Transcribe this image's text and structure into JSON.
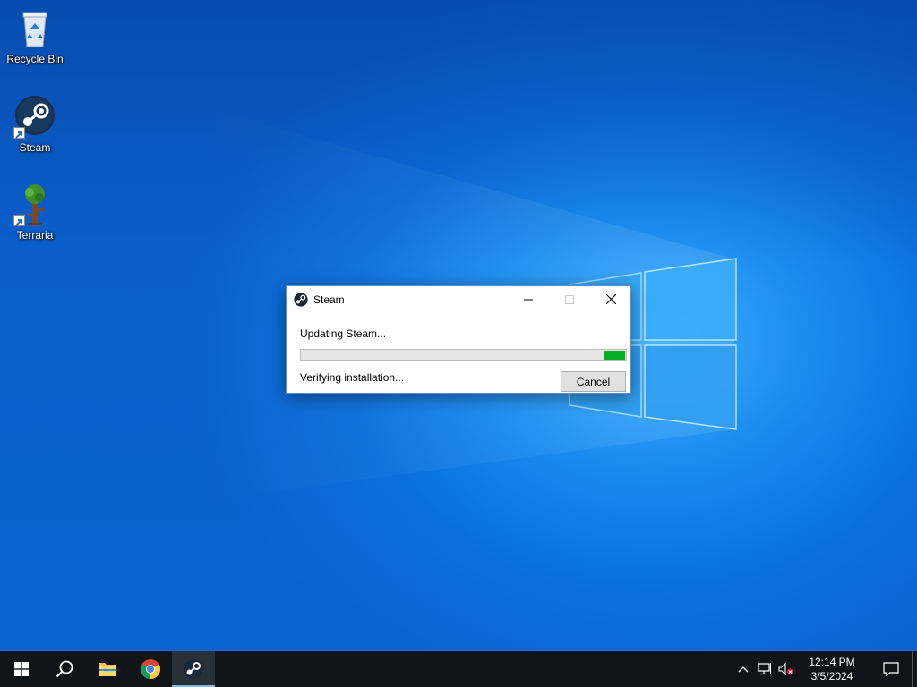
{
  "desktop": {
    "icons": [
      {
        "label": "Recycle Bin",
        "icon": "recycle-bin-icon"
      },
      {
        "label": "Steam",
        "icon": "steam-icon"
      },
      {
        "label": "Terraria",
        "icon": "terraria-icon"
      }
    ]
  },
  "dialog": {
    "title": "Steam",
    "status": "Updating Steam...",
    "detail": "Verifying installation...",
    "progress": 0.065,
    "cancel_label": "Cancel",
    "minimize_glyph": "—",
    "maximize_glyph": "☐",
    "close_glyph": "✕"
  },
  "taskbar": {
    "items": [
      {
        "name": "start-button",
        "icon": "windows-logo-icon"
      },
      {
        "name": "search-button",
        "icon": "search-icon"
      },
      {
        "name": "file-explorer",
        "icon": "folder-icon"
      },
      {
        "name": "chrome",
        "icon": "chrome-icon"
      },
      {
        "name": "steam",
        "icon": "steam-icon",
        "active": true
      }
    ],
    "tray": {
      "time": "12:14 PM",
      "date": "3/5/2024",
      "icons": [
        "chevron-up-icon",
        "network-icon",
        "volume-muted-icon",
        "notification-icon"
      ]
    }
  },
  "colors": {
    "progress_fill": "#06b025",
    "taskbar": "#101418",
    "desktop_blue": "#0b6fdc"
  }
}
